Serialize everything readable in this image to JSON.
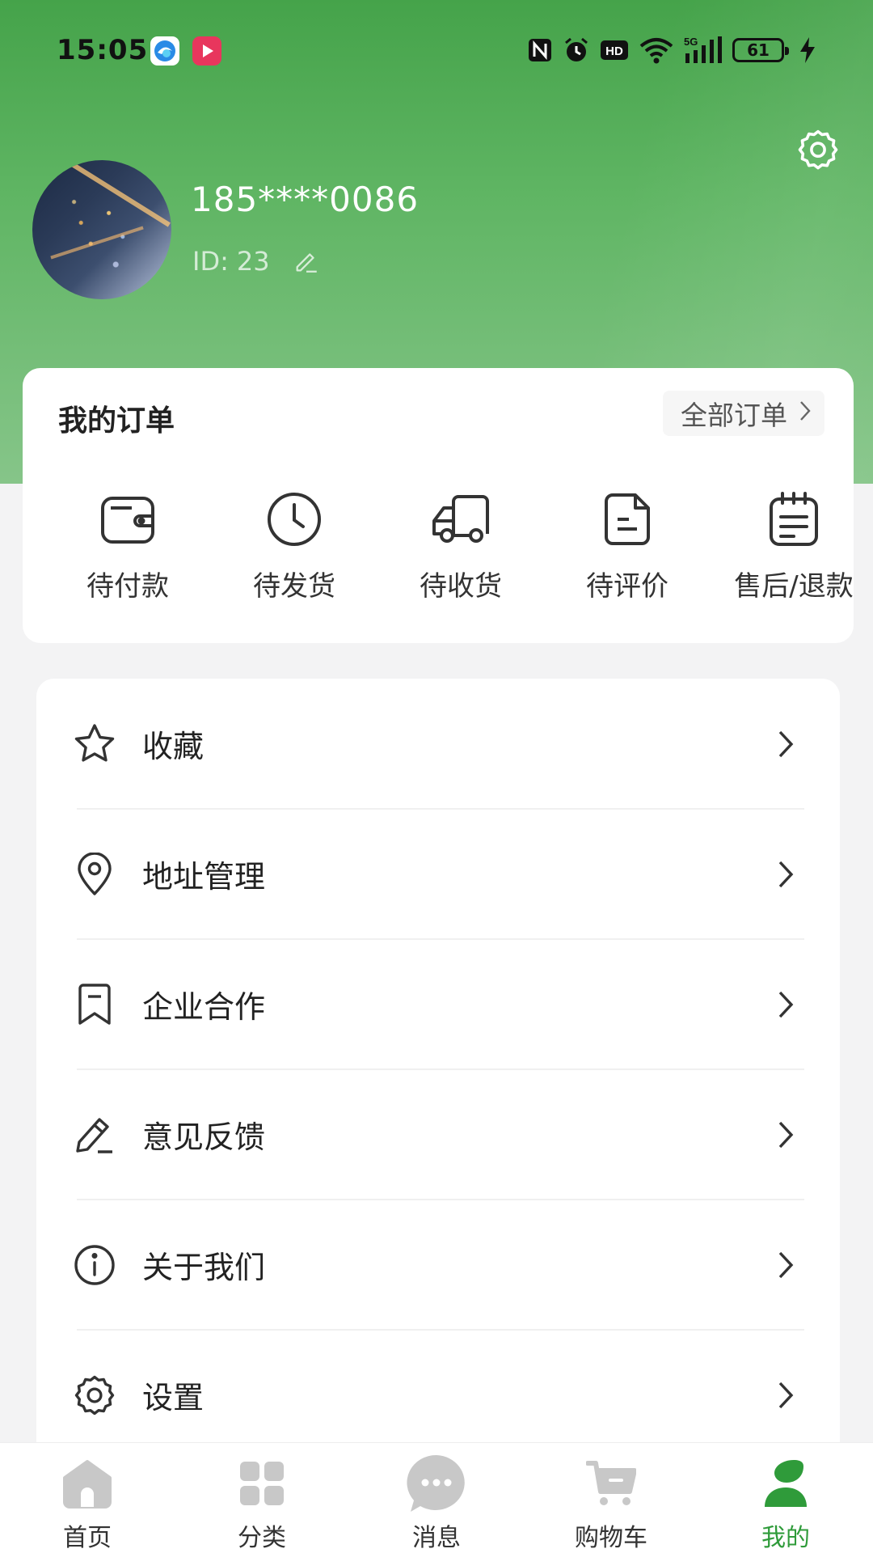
{
  "status_bar": {
    "time": "15:05",
    "battery": "61",
    "icons": [
      "browser-app-icon",
      "video-app-icon",
      "nfc-icon",
      "alarm-icon",
      "hd-icon",
      "wifi-icon",
      "5g-signal-icon",
      "battery-icon",
      "charging-icon"
    ]
  },
  "profile": {
    "phone": "185****0086",
    "id_label": "ID:",
    "id_value": "23"
  },
  "orders": {
    "title": "我的订单",
    "all_label": "全部订单",
    "items": [
      {
        "label": "待付款",
        "icon": "wallet-icon"
      },
      {
        "label": "待发货",
        "icon": "clock-icon"
      },
      {
        "label": "待收货",
        "icon": "truck-icon"
      },
      {
        "label": "待评价",
        "icon": "document-icon"
      },
      {
        "label": "售后/退款",
        "icon": "notepad-icon"
      }
    ]
  },
  "menu": {
    "items": [
      {
        "label": "收藏",
        "icon": "star-icon"
      },
      {
        "label": "地址管理",
        "icon": "location-pin-icon"
      },
      {
        "label": "企业合作",
        "icon": "bookmark-icon"
      },
      {
        "label": "意见反馈",
        "icon": "pencil-icon"
      },
      {
        "label": "关于我们",
        "icon": "info-icon"
      },
      {
        "label": "设置",
        "icon": "gear-icon"
      }
    ]
  },
  "nav": {
    "items": [
      {
        "label": "首页",
        "icon": "home-icon"
      },
      {
        "label": "分类",
        "icon": "grid-icon"
      },
      {
        "label": "消息",
        "icon": "message-icon"
      },
      {
        "label": "购物车",
        "icon": "cart-icon"
      },
      {
        "label": "我的",
        "icon": "user-icon"
      }
    ],
    "active_index": 4
  },
  "colors": {
    "brand_green": "#45a34a",
    "active_nav": "#2f9b3a",
    "inactive_nav": "#c8c8c8"
  }
}
